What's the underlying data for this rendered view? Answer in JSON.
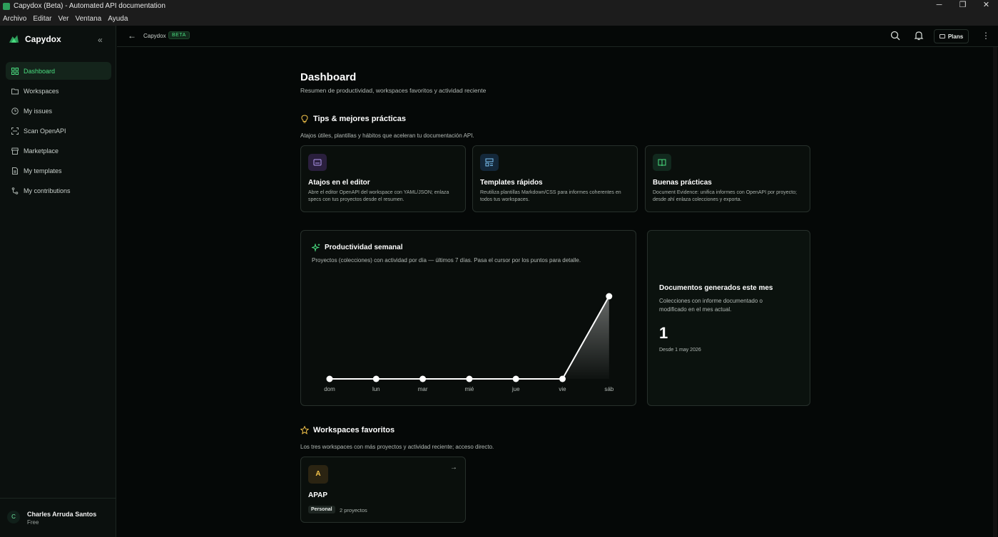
{
  "window": {
    "title": "Capydox (Beta) - Automated API documentation",
    "controls": [
      "─",
      "❐",
      "✕"
    ]
  },
  "menu": [
    "Archivo",
    "Editar",
    "Ver",
    "Ventana",
    "Ayuda"
  ],
  "brand": {
    "name": "Capydox",
    "collapse_icon": "«"
  },
  "nav": [
    {
      "label": "Dashboard",
      "icon": "grid-icon",
      "active": true
    },
    {
      "label": "Workspaces",
      "icon": "folder-icon"
    },
    {
      "label": "My issues",
      "icon": "circle-icon"
    },
    {
      "label": "Scan OpenAPI",
      "icon": "scan-icon"
    },
    {
      "label": "Marketplace",
      "icon": "store-icon"
    },
    {
      "label": "My templates",
      "icon": "file-icon"
    },
    {
      "label": "My contributions",
      "icon": "branch-icon"
    }
  ],
  "user": {
    "name": "Charles Arruda Santos",
    "plan": "Free",
    "initial": "C"
  },
  "header": {
    "back": "←",
    "crumb": "Capydox",
    "badge": "BETA",
    "plans": "Plans",
    "more": "⋮"
  },
  "page": {
    "title": "Dashboard",
    "subtitle": "Resumen de productividad, workspaces favoritos y actividad reciente"
  },
  "tips": {
    "title": "Tips & mejores prácticas",
    "subtitle": "Atajos útiles, plantillas y hábitos que aceleran tu documentación API.",
    "cards": [
      {
        "title": "Atajos en el editor",
        "desc": "Abre el editor OpenAPI del workspace con YAML/JSON; enlaza specs con tus proyectos desde el resumen.",
        "icon": "keyboard-icon",
        "color": "#2a1f3d"
      },
      {
        "title": "Templates rápidos",
        "desc": "Reutiliza plantillas Markdown/CSS para informes coherentes en todos tus workspaces.",
        "icon": "layout-icon",
        "color": "#14283a"
      },
      {
        "title": "Buenas prácticas",
        "desc": "Document Evidence: unifica informes con OpenAPI por proyecto; desde ahí enlaza colecciones y exporta.",
        "icon": "book-icon",
        "color": "#12291e"
      }
    ]
  },
  "productivity": {
    "title": "Productividad semanal",
    "subtitle": "Proyectos (colecciones) con actividad por día — últimos 7 días. Pasa el cursor por los puntos para detalle."
  },
  "chart_data": {
    "type": "line",
    "categories": [
      "dom",
      "lun",
      "mar",
      "mié",
      "jue",
      "vie",
      "sáb"
    ],
    "values": [
      0,
      0,
      0,
      0,
      0,
      0,
      1
    ],
    "ylim": [
      0,
      1
    ],
    "grid": false
  },
  "documents": {
    "title": "Documentos generados este mes",
    "desc": "Colecciones con informe documentado o modificado en el mes actual.",
    "count": "1",
    "since": "Desde 1 may 2026"
  },
  "favorites": {
    "title": "Workspaces favoritos",
    "subtitle": "Los tres workspaces con más proyectos y actividad reciente; acceso directo.",
    "items": [
      {
        "initial": "A",
        "name": "APAP",
        "badge": "Personal",
        "projects": "2 proyectos"
      }
    ]
  }
}
